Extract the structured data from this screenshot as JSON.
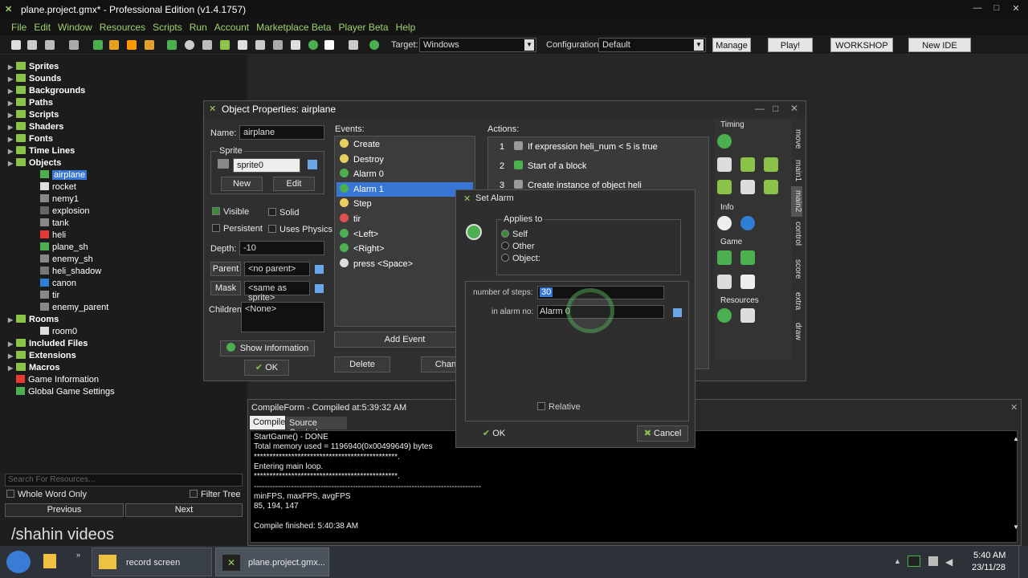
{
  "window": {
    "title": "plane.project.gmx* - Professional Edition (v1.4.1757)"
  },
  "menu": [
    "File",
    "Edit",
    "Window",
    "Resources",
    "Scripts",
    "Run",
    "Account",
    "Marketplace Beta",
    "Player Beta",
    "Help"
  ],
  "toolbar": {
    "target_label": "Target:",
    "target_value": "Windows",
    "config_label": "Configuration:",
    "config_value": "Default",
    "manage": "Manage",
    "play": "Play!",
    "workshop": "WORKSHOP",
    "newide": "New IDE"
  },
  "tree": {
    "items": [
      "Sprites",
      "Sounds",
      "Backgrounds",
      "Paths",
      "Scripts",
      "Shaders",
      "Fonts",
      "Time Lines",
      "Objects",
      "airplane",
      "rocket",
      "nemy1",
      "explosion",
      "tank",
      "heli",
      "plane_sh",
      "enemy_sh",
      "heli_shadow",
      "canon",
      "tir",
      "enemy_parent",
      "Rooms",
      "room0",
      "Included Files",
      "Extensions",
      "Macros",
      "Game Information",
      "Global Game Settings"
    ],
    "search_placeholder": "Search For Resources...",
    "whole_word": "Whole Word Only",
    "filter_tree": "Filter Tree",
    "previous": "Previous",
    "next": "Next"
  },
  "objprops": {
    "title": "Object Properties: airplane",
    "name_label": "Name:",
    "name_value": "airplane",
    "sprite_group": "Sprite",
    "sprite_value": "sprite0",
    "new": "New",
    "edit": "Edit",
    "visible": "Visible",
    "solid": "Solid",
    "persistent": "Persistent",
    "uses_physics": "Uses Physics",
    "depth_label": "Depth:",
    "depth_value": "-10",
    "parent": "Parent",
    "parent_value": "<no parent>",
    "mask": "Mask",
    "mask_value": "<same as sprite>",
    "children_label": "Children:",
    "children_value": "<None>",
    "show_info": "Show Information",
    "ok": "OK",
    "events_label": "Events:",
    "events": [
      "Create",
      "Destroy",
      "Alarm 0",
      "Alarm 1",
      "Step",
      "tir",
      "<Left>",
      "<Right>",
      "press <Space>"
    ],
    "add_event": "Add Event",
    "delete": "Delete",
    "change": "Chang",
    "actions_label": "Actions:",
    "actions": [
      {
        "n": "1",
        "t": "If expression heli_num < 5 is true"
      },
      {
        "n": "2",
        "t": "Start of a block"
      },
      {
        "n": "3",
        "t": "Create instance of object heli"
      }
    ],
    "palette_sections": [
      "Timing",
      "Info",
      "Game",
      "Resources"
    ],
    "tabs": [
      "move",
      "main1",
      "main2",
      "control",
      "score",
      "extra",
      "draw"
    ]
  },
  "alarm": {
    "title": "Set Alarm",
    "applies_to": "Applies to",
    "self": "Self",
    "other": "Other",
    "object": "Object:",
    "steps_label": "number of steps:",
    "steps_value": "30",
    "alarm_label": "in alarm no:",
    "alarm_value": "Alarm 0",
    "relative": "Relative",
    "ok": "OK",
    "cancel": "Cancel"
  },
  "compile": {
    "title": "CompileForm - Compiled at:5:39:32 AM",
    "tab_compile": "Compile",
    "tab_source": "Source Control",
    "lines": [
      "StartGame() - DONE",
      "Total memory used = 1196940(0x00499649) bytes",
      "**********************************************.",
      "Entering main loop.",
      "**********************************************.",
      "-------------------------------------------------------------------------------------",
      "minFPS, maxFPS, avgFPS",
      "85, 194, 147",
      "",
      "Compile finished: 5:40:38 AM"
    ]
  },
  "watermark": "/shahin videos",
  "taskbar": {
    "record": "record screen",
    "gm": "plane.project.gmx...",
    "time": "5:40 AM",
    "date": "23/11/28"
  }
}
